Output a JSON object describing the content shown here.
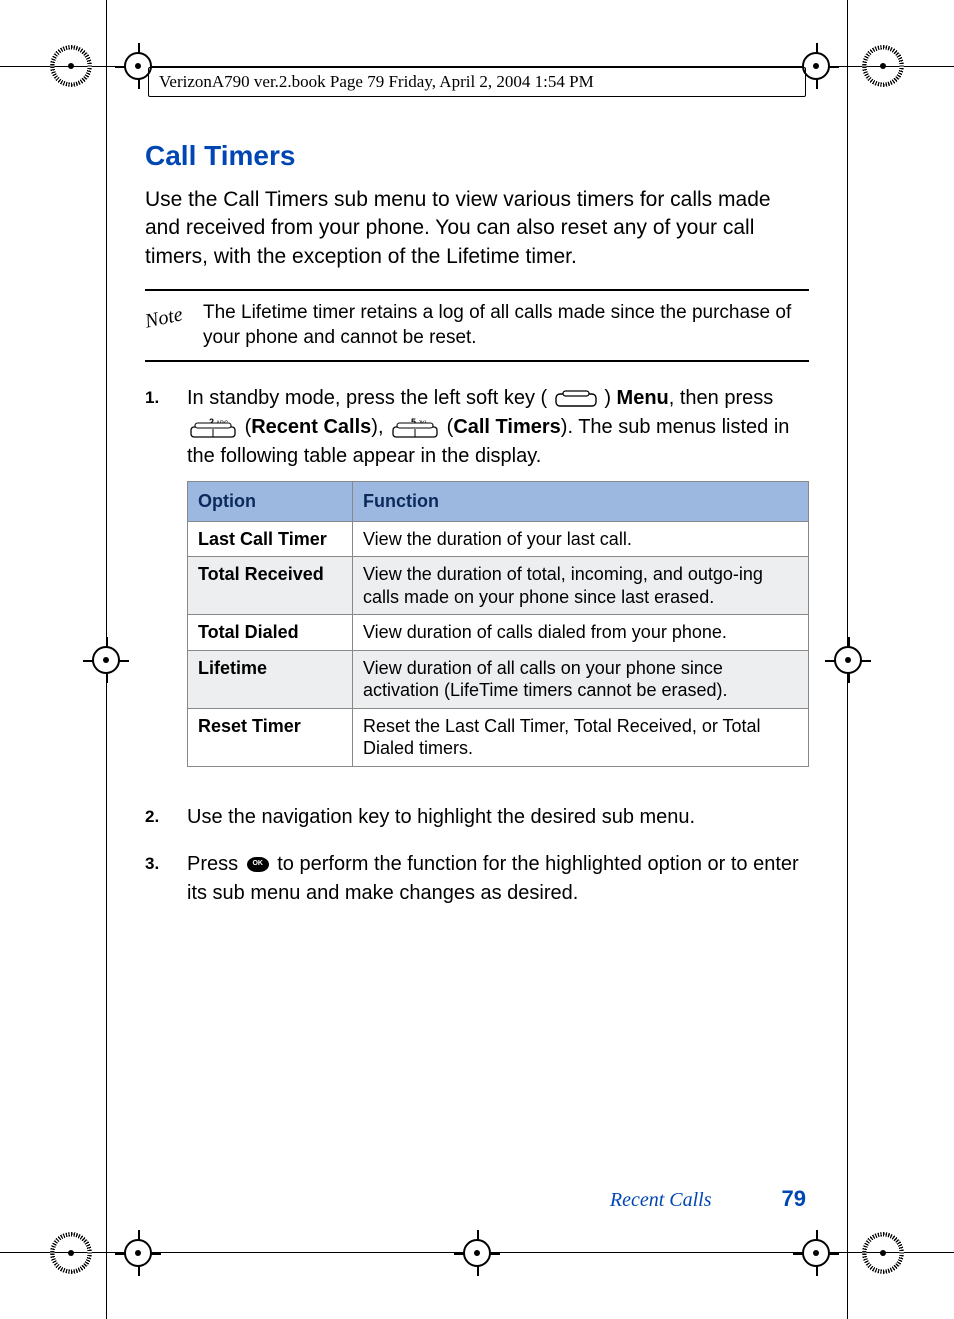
{
  "header": "VerizonA790 ver.2.book  Page 79  Friday, April 2, 2004  1:54 PM",
  "section_title": "Call Timers",
  "intro": "Use the Call Timers sub menu to view various timers for calls made and received from your phone. You can also reset any of your call timers, with the exception of the Lifetime timer.",
  "note": "The Lifetime timer retains a log of all calls made since the purchase of your phone and cannot be reset.",
  "steps": {
    "s1": {
      "num": "1.",
      "a": "In standby mode, press the left soft key (",
      "b": ") ",
      "menu": "Menu",
      "c": ", then press ",
      "key2_label": "2 ABC",
      "d": " (",
      "recent": "Recent Calls",
      "e": "), ",
      "key5_label": "5 JKL",
      "f": " (",
      "timers": "Call Timers",
      "g": "). The sub menus listed in the following table appear in the display."
    },
    "s2": {
      "num": "2.",
      "body": "Use the navigation key to highlight the desired sub menu."
    },
    "s3": {
      "num": "3.",
      "a": "Press ",
      "ok": "OK",
      "b": " to perform the function for the highlighted option or to enter its sub menu and make changes as desired."
    }
  },
  "table": {
    "head": {
      "opt": "Option",
      "fn": "Function"
    },
    "rows": [
      {
        "opt": "Last Call Timer",
        "fn": "View the duration of your last call."
      },
      {
        "opt": "Total Received",
        "fn": "View the duration of total, incoming, and outgo-ing calls made on your phone since last erased."
      },
      {
        "opt": "Total Dialed",
        "fn": "View duration of calls dialed from your phone."
      },
      {
        "opt": "Lifetime",
        "fn": "View duration of all calls on your phone since activation (LifeTime timers cannot be erased)."
      },
      {
        "opt": "Reset Timer",
        "fn": "Reset the Last Call Timer, Total Received, or Total Dialed timers."
      }
    ]
  },
  "footer": {
    "section": "Recent Calls",
    "page": "79"
  }
}
